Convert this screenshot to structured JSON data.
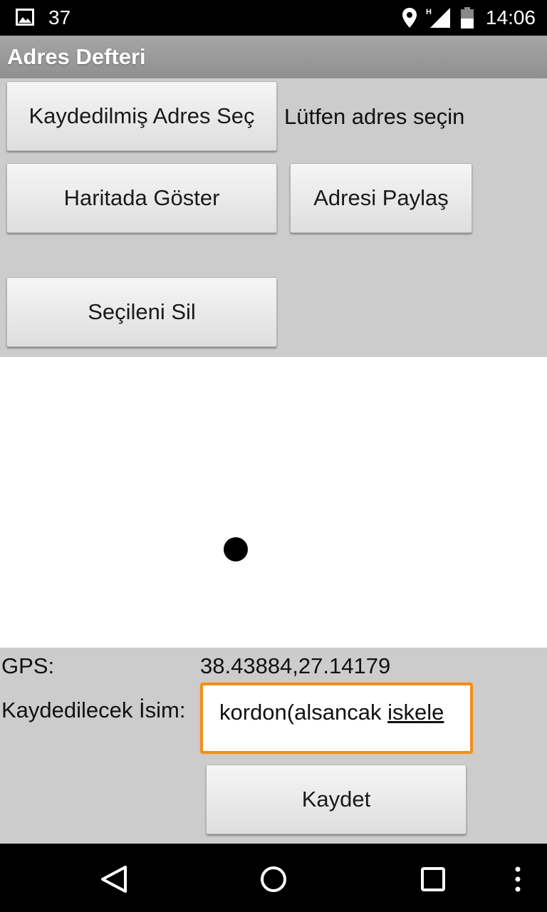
{
  "status_bar": {
    "notification_icon": "image-icon",
    "notification_count": "37",
    "icons": [
      "location-icon",
      "signal-h-icon",
      "battery-icon"
    ],
    "time": "14:06"
  },
  "app": {
    "title": "Adres Defteri"
  },
  "buttons": {
    "select_saved": "Kaydedilmiş Adres Seç",
    "show_on_map": "Haritada Göster",
    "share_address": "Adresi Paylaş",
    "delete_selected": "Seçileni Sil",
    "save": "Kaydet"
  },
  "selection_hint": "Lütfen adres seçin",
  "gps": {
    "label": "GPS:",
    "value": "38.43884,27.14179"
  },
  "name_field": {
    "label": "Kaydedilecek İsim:",
    "value_plain": "kordon(alsancak ",
    "value_underlined": "iskele"
  },
  "nav_bar": {
    "icons": [
      "back-icon",
      "home-icon",
      "recents-icon",
      "overflow-menu-icon"
    ]
  },
  "colors": {
    "background": "#cccccc",
    "title_bar": "#9a9a9a",
    "focus_border": "#f0901c"
  }
}
